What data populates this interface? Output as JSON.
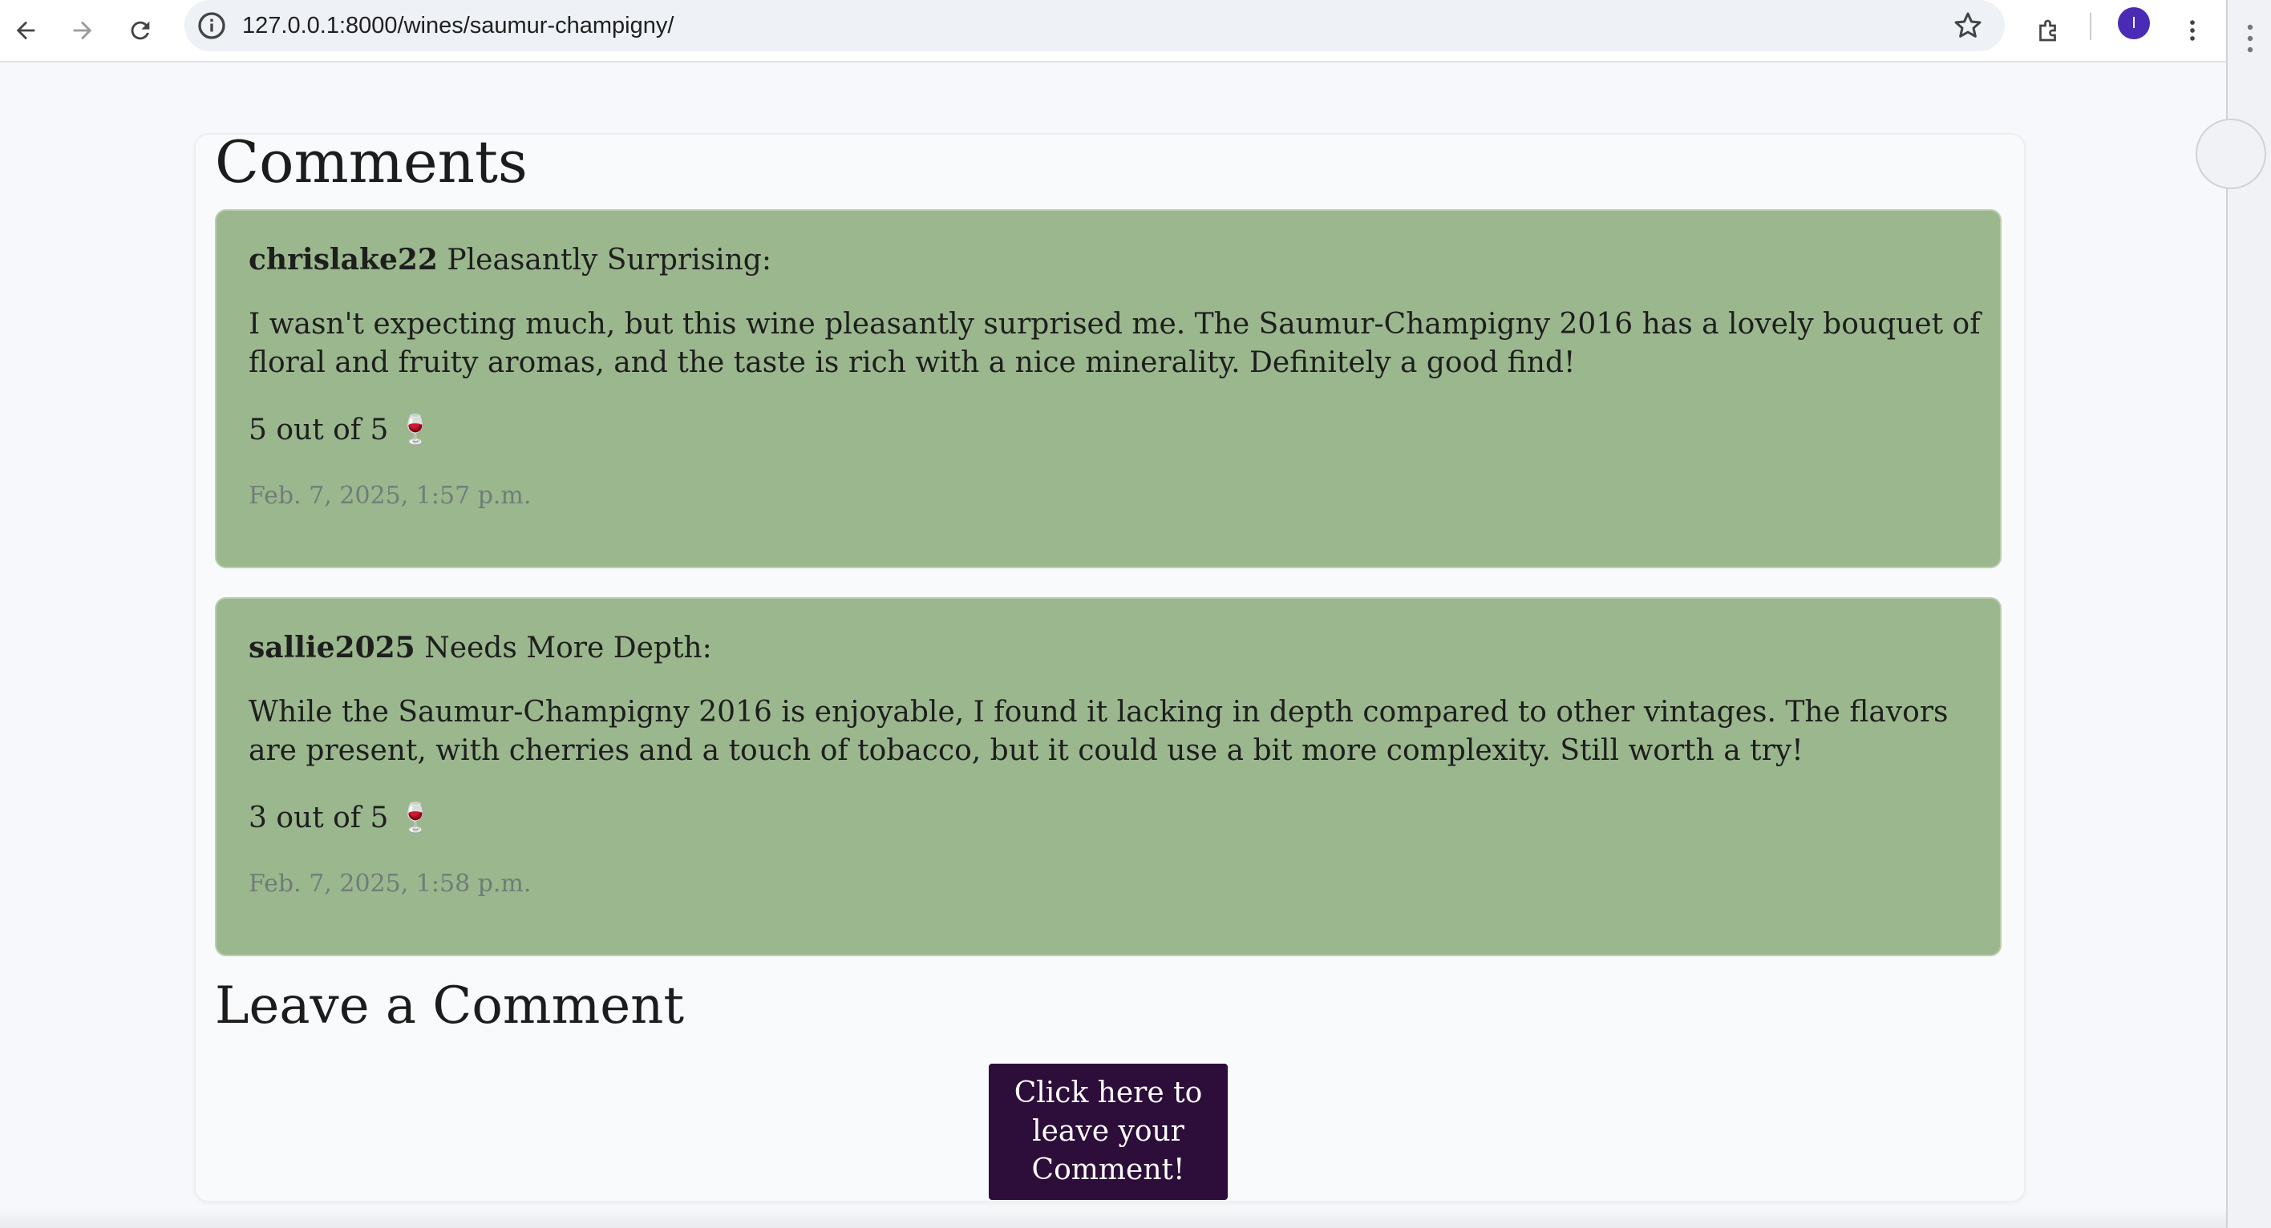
{
  "browser": {
    "url": "127.0.0.1:8000/wines/saumur-champigny/",
    "avatar_letter": "I"
  },
  "page": {
    "comments_title": "Comments",
    "leave_title": "Leave a Comment",
    "cta_label": "Click here to leave your Comment!"
  },
  "comments": [
    {
      "user": "chrislake22",
      "title": "Pleasantly Surprising:",
      "body": "I wasn't expecting much, but this wine pleasantly surprised me. The Saumur-Champigny 2016 has a lovely bouquet of floral and fruity aromas, and the taste is rich with a nice minerality. Definitely a good find!",
      "rating": "5 out of 5 🍷",
      "date": "Feb. 7, 2025, 1:57 p.m."
    },
    {
      "user": "sallie2025",
      "title": "Needs More Depth:",
      "body": "While the Saumur-Champigny 2016 is enjoyable, I found it lacking in depth compared to other vintages. The flavors are present, with cherries and a touch of tobacco, but it could use a bit more complexity. Still worth a try!",
      "rating": "3 out of 5 🍷",
      "date": "Feb. 7, 2025, 1:58 p.m."
    }
  ],
  "colors": {
    "comment_bg": "#9bb78e",
    "cta_bg": "#2d0d3a",
    "page_bg": "#f7f8fb"
  }
}
